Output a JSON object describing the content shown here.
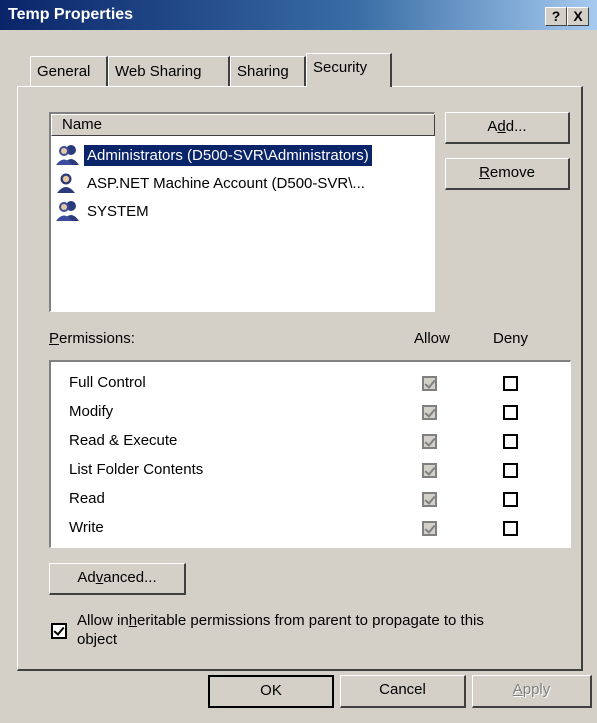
{
  "window": {
    "title": "Temp Properties",
    "help_label": "?",
    "close_label": "X"
  },
  "tabs": [
    {
      "label": "General"
    },
    {
      "label": "Web Sharing"
    },
    {
      "label": "Sharing"
    },
    {
      "label": "Security",
      "active": true
    }
  ],
  "users": {
    "column_header": "Name",
    "items": [
      {
        "name": "Administrators (D500-SVR\\Administrators)",
        "icon": "group-users-icon",
        "selected": true
      },
      {
        "name": "ASP.NET Machine Account (D500-SVR\\...",
        "icon": "user-icon",
        "selected": false
      },
      {
        "name": "SYSTEM",
        "icon": "group-users-icon",
        "selected": false
      }
    ],
    "add_pre": "A",
    "add_key": "d",
    "add_post": "d...",
    "remove_key": "R",
    "remove_post": "emove"
  },
  "permissions": {
    "label_key": "P",
    "label_post": "ermissions:",
    "allow_header": "Allow",
    "deny_header": "Deny",
    "rows": [
      {
        "name": "Full Control",
        "allow": true,
        "deny": false
      },
      {
        "name": "Modify",
        "allow": true,
        "deny": false
      },
      {
        "name": "Read & Execute",
        "allow": true,
        "deny": false
      },
      {
        "name": "List Folder Contents",
        "allow": true,
        "deny": false
      },
      {
        "name": "Read",
        "allow": true,
        "deny": false
      },
      {
        "name": "Write",
        "allow": true,
        "deny": false
      }
    ]
  },
  "advanced": {
    "pre": "Ad",
    "key": "v",
    "post": "anced..."
  },
  "inherit": {
    "checked": true,
    "pre": "Allow in",
    "key": "h",
    "post": "eritable permissions from parent to propagate to this",
    "line2": "object"
  },
  "footer": {
    "ok": "OK",
    "cancel": "Cancel",
    "apply_key": "A",
    "apply_post": "pply"
  }
}
